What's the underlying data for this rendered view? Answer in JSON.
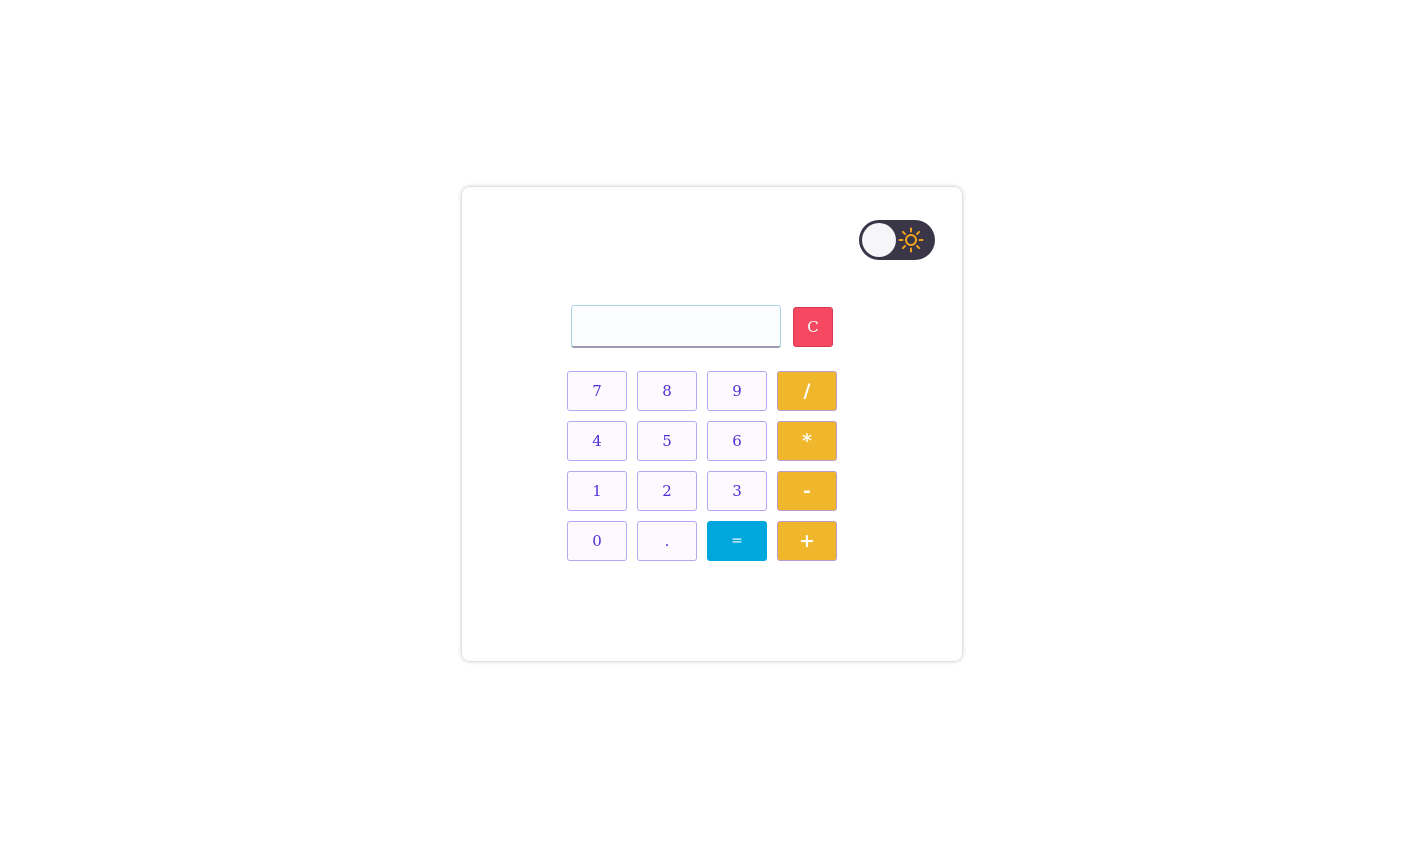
{
  "theme_toggle": {
    "icon": "sun-icon",
    "state": "light",
    "track_color": "#3a3547",
    "sun_color": "#f0a21c"
  },
  "display": {
    "value": "",
    "placeholder": ""
  },
  "clear_button": {
    "label": "C",
    "color": "#f64961"
  },
  "keypad": {
    "keys": [
      {
        "label": "7",
        "type": "num"
      },
      {
        "label": "8",
        "type": "num"
      },
      {
        "label": "9",
        "type": "num"
      },
      {
        "label": "/",
        "type": "op"
      },
      {
        "label": "4",
        "type": "num"
      },
      {
        "label": "5",
        "type": "num"
      },
      {
        "label": "6",
        "type": "num"
      },
      {
        "label": "*",
        "type": "op"
      },
      {
        "label": "1",
        "type": "num"
      },
      {
        "label": "2",
        "type": "num"
      },
      {
        "label": "3",
        "type": "num"
      },
      {
        "label": "-",
        "type": "op"
      },
      {
        "label": "0",
        "type": "num"
      },
      {
        "label": ".",
        "type": "num"
      },
      {
        "label": "=",
        "type": "eq"
      },
      {
        "label": "+",
        "type": "op"
      }
    ]
  },
  "colors": {
    "number_text": "#4b2fd3",
    "operator_bg": "#f0b62c",
    "equals_bg": "#00a7dc"
  }
}
